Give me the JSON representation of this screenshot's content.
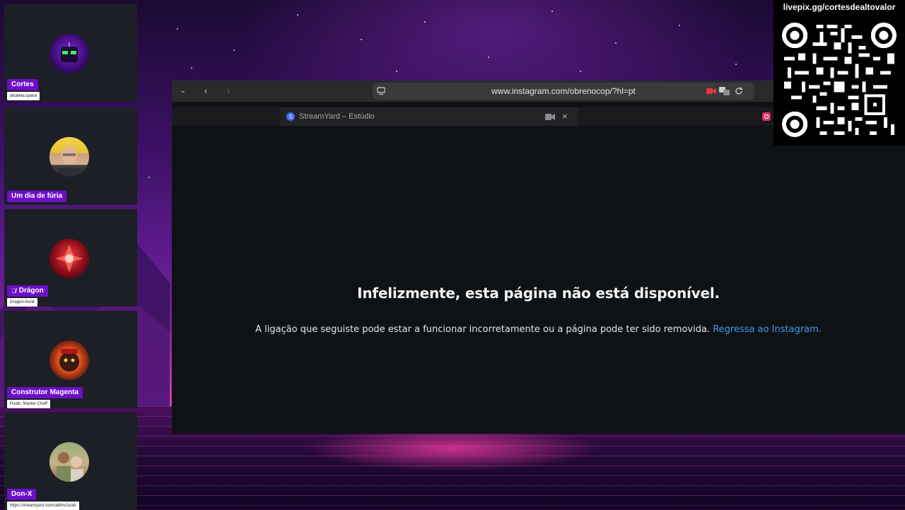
{
  "participants": [
    {
      "name": "Cortes",
      "subtitle": "alcateia.space"
    },
    {
      "name": "Um dia de fúria",
      "subtitle": ""
    },
    {
      "name": "Drägon",
      "subtitle": "Dragon-honk",
      "muted": true
    },
    {
      "name": "Construtor Magenta",
      "subtitle": "Pudin, Master Cheff"
    },
    {
      "name": "Don-X",
      "subtitle": "https://streamyard.com/ud8vv2srah"
    }
  ],
  "browser": {
    "url": "www.instagram.com/obrenocop/?hl=pt",
    "tab_title": "StreamYard – Estúdio",
    "tab_close": "×"
  },
  "page": {
    "error_title": "Infelizmente, esta página não está disponível.",
    "error_message": "A ligação que seguiste pode estar a funcionar incorretamente ou a página pode ter sido removida.",
    "error_link": "Regressa ao Instagram."
  },
  "overlay": {
    "donation_url": "livepix.gg/cortesdealtovalor"
  },
  "colors": {
    "name_tag": "#6d0fc9",
    "link": "#3e9bf0",
    "page_bg": "#0f1215"
  }
}
